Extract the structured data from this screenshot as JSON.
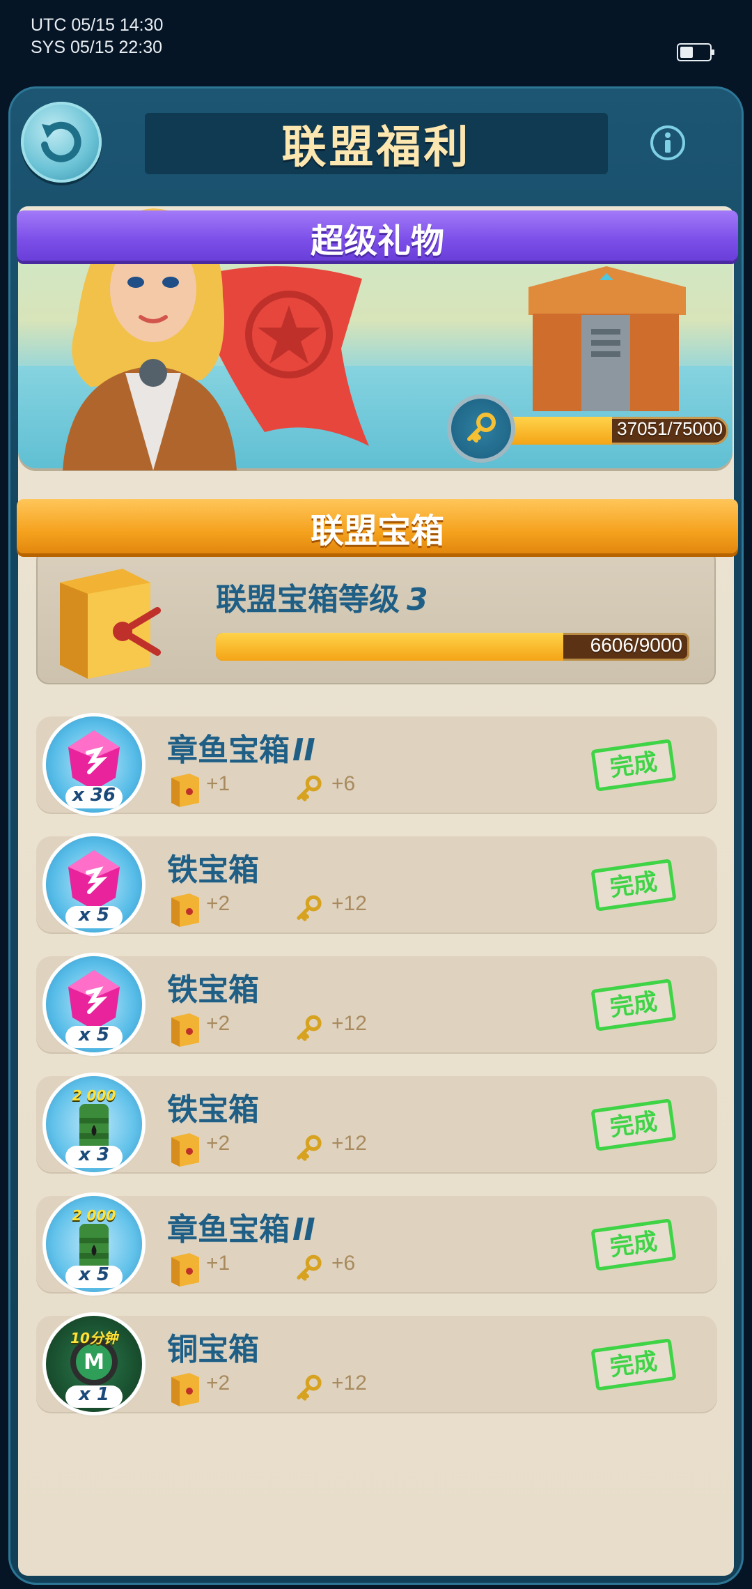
{
  "status_bar": {
    "utc": "UTC 05/15 14:30",
    "sys": "SYS 05/15 22:30"
  },
  "header": {
    "title": "联盟福利",
    "back_icon": "back-arrow-icon",
    "info_icon": "info-icon"
  },
  "super_gift": {
    "title": "超级礼物",
    "progress_text": "37051/75000",
    "progress_fraction": 0.494
  },
  "alliance_chest": {
    "title": "联盟宝箱",
    "level_label": "联盟宝箱等级",
    "level_value": "3",
    "progress_text": "6606/9000",
    "progress_fraction": 0.734
  },
  "tasks": [
    {
      "name": "章鱼宝箱",
      "suffix": "II",
      "reward_icon": "gem-icon",
      "reward_count": "x 36",
      "reward_top": "",
      "chest_bonus": "+1",
      "key_bonus": "+6",
      "status": "完成"
    },
    {
      "name": "铁宝箱",
      "suffix": "",
      "reward_icon": "gem-icon",
      "reward_count": "x 5",
      "reward_top": "",
      "chest_bonus": "+2",
      "key_bonus": "+12",
      "status": "完成"
    },
    {
      "name": "铁宝箱",
      "suffix": "",
      "reward_icon": "gem-icon",
      "reward_count": "x 5",
      "reward_top": "",
      "chest_bonus": "+2",
      "key_bonus": "+12",
      "status": "完成"
    },
    {
      "name": "铁宝箱",
      "suffix": "",
      "reward_icon": "oil-barrel-icon",
      "reward_count": "x 3",
      "reward_top": "2 000",
      "chest_bonus": "+2",
      "key_bonus": "+12",
      "status": "完成"
    },
    {
      "name": "章鱼宝箱",
      "suffix": "II",
      "reward_icon": "oil-barrel-icon",
      "reward_count": "x 5",
      "reward_top": "2 000",
      "chest_bonus": "+1",
      "key_bonus": "+6",
      "status": "完成"
    },
    {
      "name": "铜宝箱",
      "suffix": "",
      "reward_icon": "speedup-icon",
      "reward_count": "x 1",
      "reward_top": "10分钟",
      "chest_bonus": "+2",
      "key_bonus": "+12",
      "status": "完成"
    }
  ],
  "colors": {
    "title_blue": "#1f5f86",
    "accent_gold": "#f4a416",
    "stamp_green": "#3fd346"
  }
}
